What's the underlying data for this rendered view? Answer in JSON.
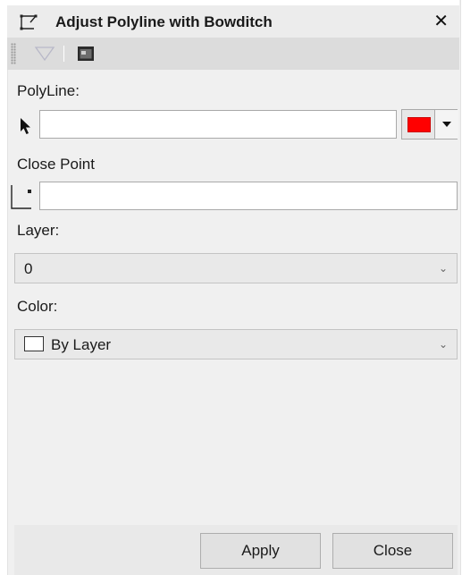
{
  "window": {
    "title": "Adjust Polyline with Bowditch",
    "close_glyph": "✕"
  },
  "toolbar": {
    "icons": [
      "grip-icon",
      "filter-funnel-icon",
      "window-icon"
    ]
  },
  "polyline": {
    "label": "PolyLine:",
    "value": "",
    "icon": "select-arrow-icon",
    "color": "#ff0000"
  },
  "close_point": {
    "label": "Close Point",
    "value": "",
    "icon": "point-pick-icon"
  },
  "layer": {
    "label": "Layer:",
    "value": "0"
  },
  "color": {
    "label": "Color:",
    "value": "By Layer"
  },
  "buttons": {
    "apply": "Apply",
    "close": "Close"
  }
}
